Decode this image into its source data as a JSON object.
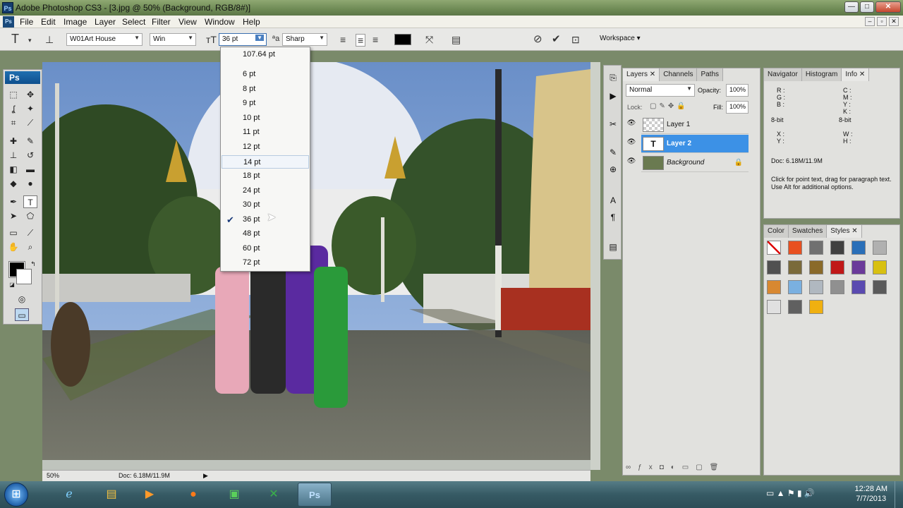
{
  "window": {
    "title": "Adobe Photoshop CS3 - [3.jpg @ 50% (Background, RGB/8#)]",
    "app_badge": "Ps"
  },
  "menu": [
    "File",
    "Edit",
    "Image",
    "Layer",
    "Select",
    "Filter",
    "View",
    "Window",
    "Help"
  ],
  "options": {
    "font_family": "W01Art House",
    "font_style": "Win",
    "font_size": "36 pt",
    "anti_alias": "Sharp",
    "workspace_label": "Workspace ▾",
    "text_color": "#000000"
  },
  "size_dropdown": {
    "items": [
      "107.64 pt",
      "6 pt",
      "8 pt",
      "9 pt",
      "10 pt",
      "11 pt",
      "12 pt",
      "14 pt",
      "18 pt",
      "24 pt",
      "30 pt",
      "36 pt",
      "48 pt",
      "60 pt",
      "72 pt"
    ],
    "checked": "36 pt",
    "hovered": "14 pt"
  },
  "toolbox": {
    "logo": "Ps"
  },
  "status": {
    "zoom": "50%",
    "doc": "Doc: 6.18M/11.9M"
  },
  "layers_panel": {
    "tabs": [
      "Layers",
      "Channels",
      "Paths"
    ],
    "blend_mode": "Normal",
    "opacity_label": "Opacity:",
    "opacity": "100%",
    "lock_label": "Lock:",
    "fill_label": "Fill:",
    "fill": "100%",
    "layers": [
      {
        "name": "Layer 1",
        "selected": false
      },
      {
        "name": "Layer 2",
        "selected": true
      },
      {
        "name": "Background",
        "selected": false
      }
    ]
  },
  "info_panel": {
    "tabs": [
      "Navigator",
      "Histogram",
      "Info"
    ],
    "rgb": [
      "R :",
      "G :",
      "B :"
    ],
    "cmyk": [
      "C :",
      "M :",
      "Y :",
      "K :"
    ],
    "bitdepth_left": "8-bit",
    "bitdepth_right": "8-bit",
    "xy": [
      "X :",
      "Y :"
    ],
    "wh": [
      "W :",
      "H :"
    ],
    "doc": "Doc: 6.18M/11.9M",
    "hint": "Click for point text, drag for paragraph text. Use Alt for additional options."
  },
  "styles_panel": {
    "tabs": [
      "Color",
      "Swatches",
      "Styles"
    ],
    "swatches": [
      "#ffffff",
      "#e85020",
      "#707070",
      "#404040",
      "#2a6fb8",
      "#b0b0b0",
      "#505050",
      "#7a6a3a",
      "#8a6a2a",
      "#c01818",
      "#6a3a9a",
      "#d8c010",
      "#d88830",
      "#7ab0e0",
      "#b0b8c0",
      "#909090",
      "#5a4ab0",
      "#5a5a5a",
      "#e0e0e0",
      "#606060",
      "#f0b010"
    ]
  },
  "taskbar": {
    "time": "12:28 AM",
    "date": "7/7/2013",
    "apps": [
      "ie",
      "explorer",
      "media",
      "firefox",
      "terminal",
      "excel",
      "photoshop"
    ],
    "active_app": "Ps"
  }
}
